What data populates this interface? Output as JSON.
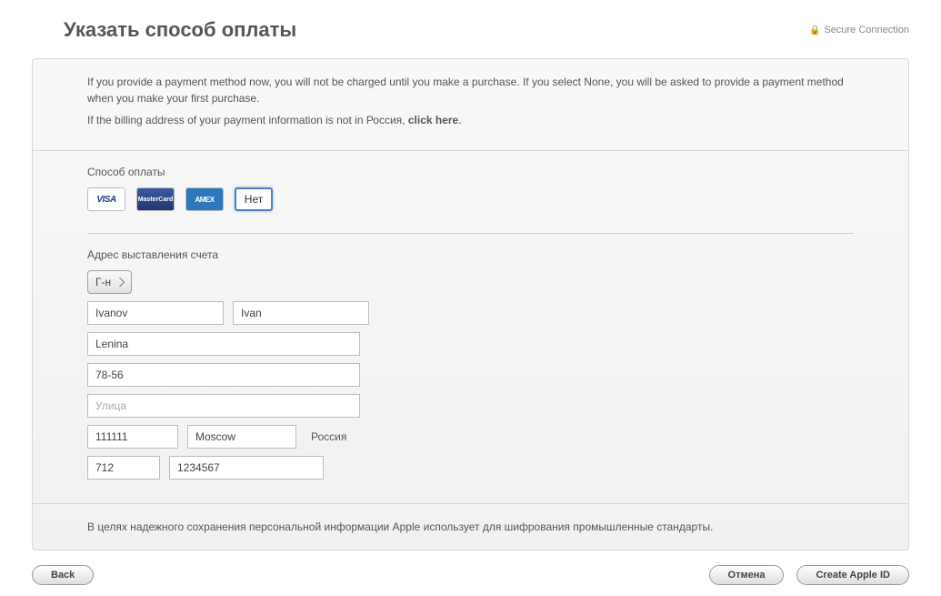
{
  "header": {
    "title": "Указать способ оплаты",
    "secure_label": "Secure Connection"
  },
  "intro": {
    "line1": "If you provide a payment method now, you will not be charged until you make a purchase. If you select None, you will be asked to provide a payment method when you make your first purchase.",
    "line2_prefix": "If the billing address of your payment information is not in Россия, ",
    "line2_link": "click here",
    "line2_suffix": "."
  },
  "payment": {
    "label": "Способ оплаты",
    "options": {
      "visa": "VISA",
      "mastercard": "MasterCard",
      "amex": "AMEX",
      "none": "Нет"
    },
    "selected": "none"
  },
  "billing": {
    "label": "Адрес выставления счета",
    "salutation": "Г-н",
    "last_name": "Ivanov",
    "first_name": "Ivan",
    "street1": "Lenina",
    "street2": "78-56",
    "street3_placeholder": "Улица",
    "postal": "111111",
    "city": "Moscow",
    "country": "Россия",
    "phone_code": "712",
    "phone_number": "1234567"
  },
  "footer": {
    "note": "В целях надежного сохранения персональной информации Apple использует для шифрования промышленные стандарты."
  },
  "buttons": {
    "back": "Back",
    "cancel": "Отмена",
    "create": "Create Apple ID"
  }
}
